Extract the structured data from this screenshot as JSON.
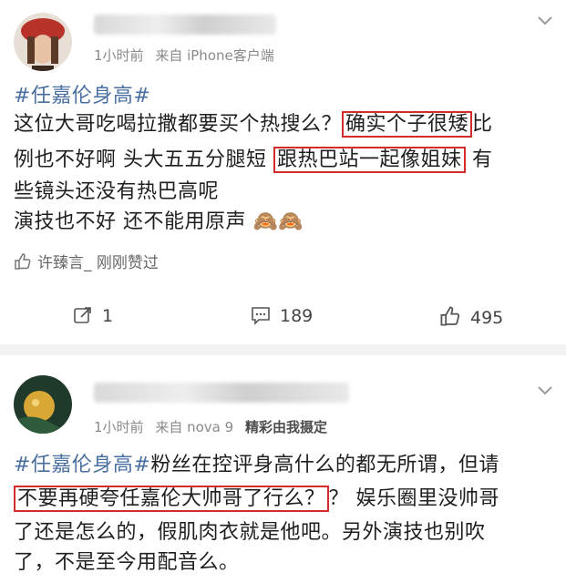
{
  "post1": {
    "time": "1小时前",
    "source": "来自 iPhone客户端",
    "lines": [
      {
        "tag": "#任嘉伦身高#"
      },
      {
        "pre": "这位大哥吃喝拉撒都要买个热搜么？",
        "box": "确实个子很矮",
        "post": "比"
      },
      {
        "pre": "例也不好啊 头大五五分腿短 ",
        "box": "跟热巴站一起像姐妹",
        "post": " 有"
      },
      {
        "pre": "些镜头还没有热巴高呢"
      },
      {
        "pre": "演技也不好 还不能用原声 🙈🙈"
      }
    ],
    "liked_by": "许臻言_ 刚刚赞过",
    "actions": {
      "repost": "1",
      "comment": "189",
      "like": "495"
    }
  },
  "post2": {
    "time": "1小时前",
    "source": "来自 nova 9",
    "source_extra": "精彩由我摄定",
    "lines": [
      {
        "tag": "#任嘉伦身高#",
        "post": "粉丝在控评身高什么的都无所谓，但请"
      },
      {
        "box": "不要再硬夸任嘉伦大帅哥了行么？",
        "post": "？ 娱乐圈里没帅哥"
      },
      {
        "pre": "了还是怎么的，假肌肉衣就是他吧。另外演技也别吹"
      },
      {
        "pre": "了，不是至今用配音么。"
      }
    ]
  },
  "colors": {
    "topic": "#4a6fa1",
    "highlight_box": "#d42b2b",
    "meta": "#8a8a8a"
  },
  "icons": [
    "chevron-down-icon",
    "thumb-up-icon",
    "repost-icon",
    "comment-icon",
    "like-icon"
  ]
}
